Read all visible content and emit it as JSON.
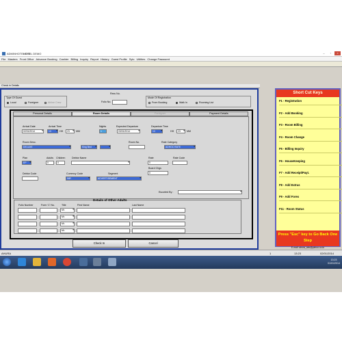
{
  "window": {
    "app_name": "ADMINHOTELSYS",
    "tab_title": "HOTEL DEMO"
  },
  "menu": [
    "File",
    "Masters",
    "Front Office",
    "Advance Booking",
    "Cashier",
    "Billing",
    "Inquiry",
    "Report",
    "History",
    "Guest Profile",
    "Sytc",
    "Utilities",
    "Change Password"
  ],
  "page_title": "Check in Details",
  "guest_type": {
    "label": "Type Of Guest",
    "options": [
      "Local",
      "Foreigner",
      "Airline Crew"
    ],
    "selected": "Local"
  },
  "reservation": {
    "resv_no_label": "Resv No.",
    "folio_label": "Folio No."
  },
  "registration_mode": {
    "label": "Mode Of Registration",
    "options": [
      "From Booking",
      "Walk In",
      "Rooming List"
    ],
    "selected": "Walk In"
  },
  "tabs": [
    {
      "label": "Personal Details",
      "state": "normal"
    },
    {
      "label": "Room Details",
      "state": "active"
    },
    {
      "label": "Foreigner",
      "state": "dim"
    },
    {
      "label": "Payment Details",
      "state": "normal"
    }
  ],
  "room": {
    "arrival_date_label": "Arrival Date",
    "arrival_date": "02/01/2014",
    "arrival_time_label": "Arrival Time",
    "arrival_hh": "13",
    "hh": "HH",
    "arrival_mm": "23",
    "mm": "MM",
    "nights_label": "Nights",
    "nights": "1",
    "expected_departure_label": "Expected Departure",
    "expected_departure": "03/01/2014",
    "departure_time_label": "Departure Time",
    "departure_hh": "13",
    "departure_mm": "23",
    "room_desc_label": "Room Desc.",
    "room_desc": "DELUXE",
    "bed_type": "King Bed",
    "room_no_label": "Room No.",
    "rate_category_label": "Rate Category",
    "rate_category": "ADHOC RATE",
    "plan_label": "Plan",
    "plan": "EP",
    "adults_label": "Adults",
    "adults": "0",
    "children_label": "Children",
    "children": "0",
    "debtor_name_label": "Debtor Name",
    "rate_label": "Rate",
    "rate": "0",
    "rate_code_label": "Rate Code",
    "board_chgs_label": "Board Chgs",
    "board_chgs": "0",
    "debtor_code_label": "Debtor Code",
    "currency_code_label": "Currency Code",
    "currency_code": "INR",
    "segment_label": "Segment",
    "segment": "ADVERTISEMENT",
    "escorted_by_label": "Escorted By :"
  },
  "adults_table": {
    "title": "Details of Other Adults",
    "headers": [
      "Folio Number",
      "Form 'C' No.",
      "Title",
      "First Name",
      "Last Name"
    ],
    "title_default": "Mr.",
    "rows": 4
  },
  "buttons": {
    "check_in": "Check In",
    "cancel": "Cancel"
  },
  "shortcuts": {
    "title": "Short Cut Keys",
    "items": [
      "F1 - Registration",
      "F2 - Add Booking",
      "F3 - Room Billing",
      "F4 - Room Change",
      "F5 - Billing Inquiry",
      "F6 - HouseKeeping",
      "F7 - Add Receipt/Payt.",
      "F8 - Add Extras",
      "F9 - Add Forex",
      "F11 - Room Status"
    ],
    "footer": "Press \"Esc\" key to Go Back One Step",
    "email": "E-mail: ahura_abc@yahoo.co.in"
  },
  "statusbar": {
    "user": "AHURA",
    "count": "1",
    "time": "13:23",
    "date": "02/01/2014"
  },
  "taskbar": {
    "clock_time": "13:23",
    "clock_date": "01/01/2014"
  },
  "colors": {
    "shortcut_bg": "#ffff99",
    "shortcut_head": "#e83820",
    "selected_field": "#3d6ad6",
    "taskbar": "#2f4b74"
  }
}
